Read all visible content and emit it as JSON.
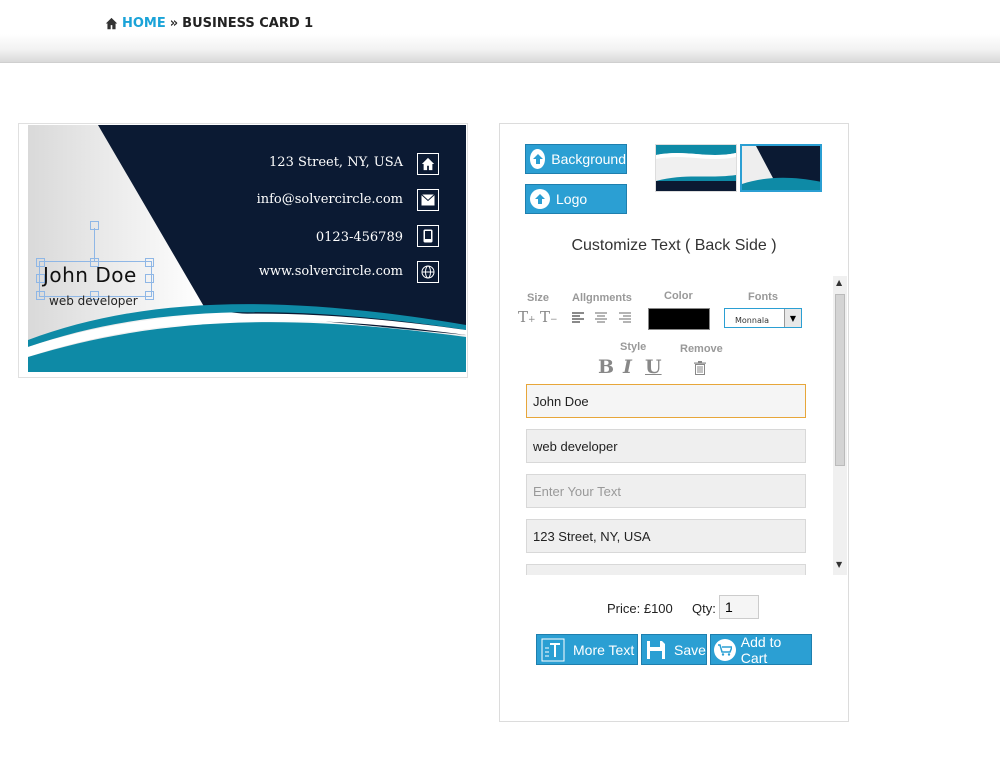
{
  "breadcrumb": {
    "home_label": "HOME",
    "separator": "»",
    "current_label": "BUSINESS CARD 1"
  },
  "card": {
    "name": "John Doe",
    "job_title": "web developer",
    "address": "123 Street, NY, USA",
    "email": "info@solvercircle.com",
    "phone": "0123-456789",
    "website": "www.solvercircle.com",
    "colors": {
      "navy": "#0b1a33",
      "teal": "#0e8aa6",
      "light": "#f2f2f2"
    }
  },
  "panel": {
    "background_button": "Background",
    "logo_button": "Logo",
    "customize_title": "Customize Text ( Back Side )",
    "tools": {
      "size_label": "Size",
      "alignments_label": "Allgnments",
      "color_label": "Color",
      "fonts_label": "Fonts",
      "style_label": "Style",
      "remove_label": "Remove",
      "font_value": "Monnala",
      "color_value": "#000000"
    },
    "fields": [
      {
        "value": "John Doe",
        "placeholder": ""
      },
      {
        "value": "web developer",
        "placeholder": ""
      },
      {
        "value": "",
        "placeholder": "Enter Your Text"
      },
      {
        "value": "123 Street, NY, USA",
        "placeholder": ""
      },
      {
        "value": "",
        "placeholder": ""
      }
    ],
    "price_text": "Price: £100",
    "qty_label": "Qty:",
    "qty_value": "1",
    "more_text_button": "More Text",
    "save_button": "Save",
    "add_to_cart_button": "Add to Cart",
    "accent_color": "#2b9fd3"
  }
}
